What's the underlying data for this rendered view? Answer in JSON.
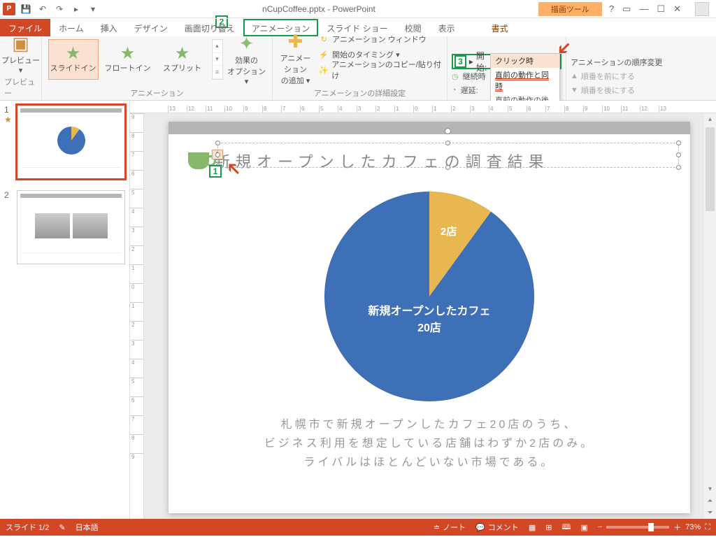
{
  "window": {
    "title": "nCupCoffee.pptx - PowerPoint",
    "context_tool_header": "描画ツール"
  },
  "tabs": {
    "file": "ファイル",
    "home": "ホーム",
    "insert": "挿入",
    "design": "デザイン",
    "transitions": "画面切り替え",
    "animations": "アニメーション",
    "slideshow": "スライド ショー",
    "review": "校閲",
    "view": "表示",
    "format": "書式"
  },
  "ribbon": {
    "preview_label": "プレビュー",
    "preview_group": "プレビュー",
    "anim_gallery": {
      "slide_in": "スライドイン",
      "float_in": "フロートイン",
      "split": "スプリット"
    },
    "anim_group": "アニメーション",
    "effect_options": "効果の\nオプション ▾",
    "add_animation": "アニメーション\nの追加 ▾",
    "adv": {
      "pane": "アニメーション ウィンドウ",
      "trigger": "開始のタイミング ▾",
      "painter": "アニメーションのコピー/貼り付け",
      "group": "アニメーションの詳細設定"
    },
    "timing": {
      "start_label": "開始:",
      "start_value": "クリック時",
      "duration_label": "継続時",
      "delay_label": "遅延:"
    },
    "start_dropdown": {
      "on_click": "クリック時",
      "with_previous": "直前の動作と同時",
      "after_previous": "直前の動作の後"
    },
    "reorder": {
      "header": "アニメーションの順序変更",
      "earlier": "順番を前にする",
      "later": "順番を後にする"
    }
  },
  "annotations": {
    "one": "1",
    "two": "2",
    "three": "3"
  },
  "slide": {
    "anim_tag": "1",
    "title": "新規オープンしたカフェの調査結果",
    "caption_l1": "札幌市で新規オープンしたカフェ20店のうち、",
    "caption_l2": "ビジネス利用を想定している店舗はわずか2店のみ。",
    "caption_l3": "ライバルはほとんどいない市場である。"
  },
  "chart_data": {
    "type": "pie",
    "title": "",
    "series": [
      {
        "name": "2店",
        "value": 2,
        "color": "#e8b74f"
      },
      {
        "name": "新規オープンしたカフェ\n20店",
        "value": 18,
        "color": "#3e70b8"
      }
    ],
    "labels": {
      "small_slice": "2店",
      "big_slice_l1": "新規オープンしたカフェ",
      "big_slice_l2": "20店"
    }
  },
  "ruler": [
    "13",
    "12",
    "11",
    "10",
    "9",
    "8",
    "7",
    "6",
    "5",
    "4",
    "3",
    "2",
    "1",
    "0",
    "1",
    "2",
    "3",
    "4",
    "5",
    "6",
    "7",
    "8",
    "9",
    "10",
    "11",
    "12",
    "13"
  ],
  "ruler_v": [
    "9",
    "8",
    "7",
    "6",
    "5",
    "4",
    "3",
    "2",
    "1",
    "0",
    "1",
    "2",
    "3",
    "4",
    "5",
    "6",
    "7",
    "8",
    "9"
  ],
  "status": {
    "slide": "スライド 1/2",
    "lang": "日本語",
    "notes": "ノート",
    "comments": "コメント",
    "zoom": "73%"
  },
  "thumbs": {
    "n1": "1",
    "n2": "2"
  }
}
